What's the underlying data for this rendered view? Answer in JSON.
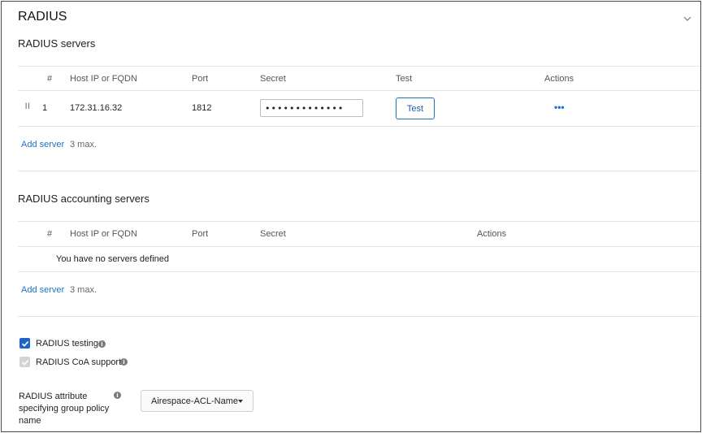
{
  "section": {
    "title": "RADIUS",
    "collapse_icon": "chevron-down-icon"
  },
  "radius_servers": {
    "title": "RADIUS servers",
    "columns": {
      "num": "#",
      "host": "Host IP or FQDN",
      "port": "Port",
      "secret": "Secret",
      "test": "Test",
      "actions": "Actions"
    },
    "rows": [
      {
        "num": "1",
        "host": "172.31.16.32",
        "port": "1812",
        "secret": "•••••••••••••",
        "test_label": "Test",
        "actions_icon": "more-horizontal-icon"
      }
    ],
    "add_label": "Add server",
    "max_label": "3 max."
  },
  "accounting_servers": {
    "title": "RADIUS accounting servers",
    "columns": {
      "num": "#",
      "host": "Host IP or FQDN",
      "port": "Port",
      "secret": "Secret",
      "actions": "Actions"
    },
    "empty_text": "You have no servers defined",
    "add_label": "Add server",
    "max_label": "3 max."
  },
  "options": {
    "radius_testing": {
      "label": "RADIUS testing",
      "checked": true
    },
    "coa_support": {
      "label": "RADIUS CoA support",
      "checked": true,
      "disabled": true
    }
  },
  "group_policy": {
    "label_line1": "RADIUS attribute",
    "label_line2": "specifying group policy",
    "label_line3": "name",
    "selected": "Airespace-ACL-Name"
  },
  "colors": {
    "accent": "#1a73c9",
    "checkbox": "#1e63c8",
    "disabled": "#d4d4d4"
  }
}
